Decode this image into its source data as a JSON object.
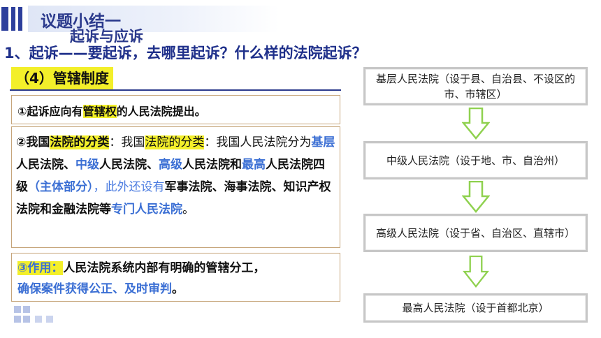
{
  "header": {
    "title": "议题小结一",
    "subtitle": "起诉与应诉",
    "question": "1、起诉——要起诉，去哪里起诉？什么样的法院起诉？"
  },
  "section": {
    "heading": "（4）管辖制度"
  },
  "point1": {
    "pre": "①起诉应向有",
    "hl": "管辖权",
    "post": "的人民法院提出。"
  },
  "point2": {
    "num": "②我国",
    "hl1": "法院的分类",
    "mid1": "：我国",
    "hl2": "法院的分类",
    "mid2": "：我国人民法院分为",
    "k1": "基层",
    "t1": "人民法院、",
    "k2": "中级",
    "t2": "人民法院、",
    "k3": "高级",
    "t3": "人民法院和",
    "k4": "最高",
    "t4": "人民法院四级",
    "paren": "（主体部分）",
    "comma": "，此外还设有",
    "special": "军事法院、海事法院、知识产权法院和金融法院",
    "t5": "等",
    "k5": "专门人民法院",
    "end": "。"
  },
  "point3": {
    "label": "③作用：",
    "text1": "人民法院系统内部有明确的管辖分工，",
    "text2": "确保案件获得公正、及时审判",
    "end": "。"
  },
  "flow": [
    "基层人民法院（设于县、自治县、不设区的市、市辖区）",
    "中级人民法院（设于地、市、自治州）",
    "高级人民法院（设于省、自治区、直辖市）",
    "最高人民法院（设于首都北京）"
  ],
  "colors": {
    "title": "#2b3a8c",
    "highlight": "#f3ef2a",
    "keyword": "#3b6fd4",
    "arrow": "#8fd14f"
  },
  "icons": [
    "title-bars-icon",
    "down-arrow-icon",
    "decorative-squares-icon"
  ]
}
